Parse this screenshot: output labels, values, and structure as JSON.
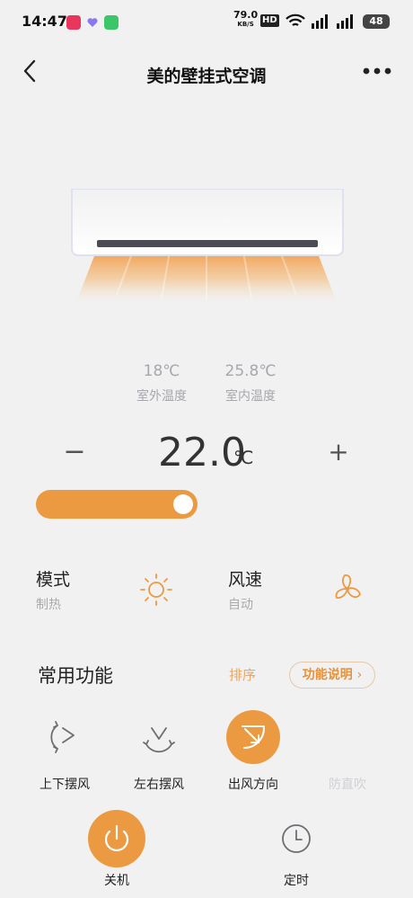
{
  "status_bar": {
    "time": "14:47",
    "net_speed": "79.0",
    "net_unit": "KB/S",
    "hd": "HD",
    "battery": "48"
  },
  "header": {
    "title": "美的壁挂式空调"
  },
  "temps": {
    "outdoor_value": "18℃",
    "outdoor_label": "室外温度",
    "indoor_value": "25.8℃",
    "indoor_label": "室内温度"
  },
  "setpoint": {
    "minus": "−",
    "value": "22.0",
    "unit": "℃",
    "plus": "+"
  },
  "mode": {
    "title": "模式",
    "value": "制热"
  },
  "fan_speed": {
    "title": "风速",
    "value": "自动"
  },
  "functions": {
    "title": "常用功能",
    "sort": "排序",
    "help": "功能说明",
    "items": [
      {
        "label": "上下摆风"
      },
      {
        "label": "左右摆风"
      },
      {
        "label": "出风方向"
      },
      {
        "label": "防直吹"
      }
    ]
  },
  "bottom": {
    "power_label": "关机",
    "timer_label": "定时"
  },
  "colors": {
    "accent": "#ec9a42",
    "background": "#f1f1f1",
    "muted": "#a7a7ae"
  }
}
